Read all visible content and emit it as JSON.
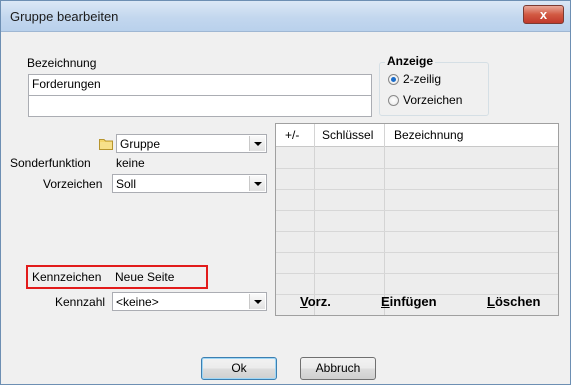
{
  "window": {
    "title": "Gruppe bearbeiten",
    "close_label": "x"
  },
  "bezeichnung": {
    "label": "Bezeichnung",
    "line1": "Forderungen",
    "line2": ""
  },
  "anzeige": {
    "label": "Anzeige",
    "options": [
      {
        "label": "2-zeilig",
        "selected": true
      },
      {
        "label": "Vorzeichen",
        "selected": false
      }
    ]
  },
  "form": {
    "gruppe": {
      "label": "",
      "value": "Gruppe",
      "icon": "folder-icon"
    },
    "sonderfunktion": {
      "label": "Sonderfunktion",
      "value": "keine"
    },
    "vorzeichen": {
      "label": "Vorzeichen",
      "value": "Soll"
    },
    "kennzeichen": {
      "label": "Kennzeichen",
      "value": "Neue Seite"
    },
    "kennzahl": {
      "label": "Kennzahl",
      "value": "<keine>"
    }
  },
  "grid": {
    "columns": [
      "+/-",
      "Schlüssel",
      "Bezeichnung"
    ],
    "rows": [],
    "buttons": {
      "vorz": {
        "mnemonic": "V",
        "rest": "orz."
      },
      "einfuegen": {
        "mnemonic": "E",
        "rest": "infügen"
      },
      "loeschen": {
        "mnemonic": "L",
        "rest": "öschen"
      }
    }
  },
  "buttons": {
    "ok": "Ok",
    "cancel": "Abbruch"
  },
  "colors": {
    "highlight_border": "#e21b1b",
    "title_bar": "#c3d7ee",
    "close_button": "#c0392b"
  }
}
